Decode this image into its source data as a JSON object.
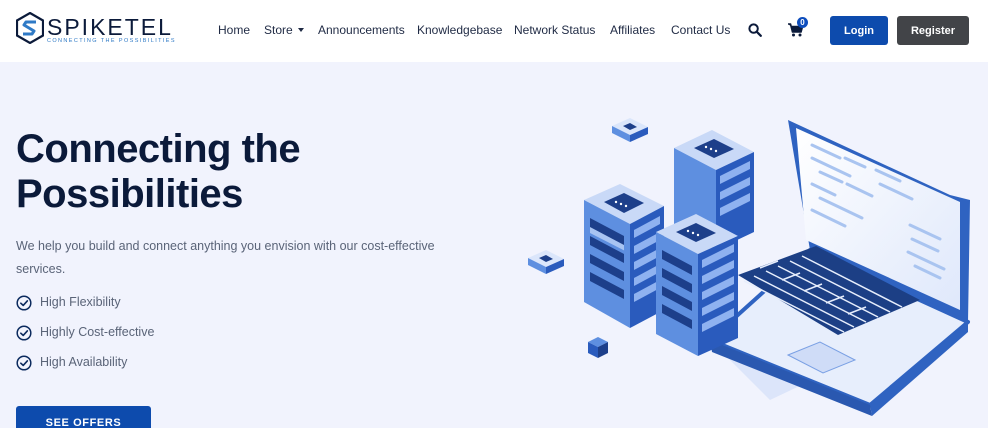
{
  "brand": {
    "name": "SPIKETEL",
    "tagline": "Connecting the Possibilities",
    "primary_color": "#0d4bad",
    "accent_color": "#2f7ac6"
  },
  "nav": {
    "items": [
      {
        "label": "Home"
      },
      {
        "label": "Store",
        "dropdown": true
      },
      {
        "label": "Announcements"
      },
      {
        "label": "Knowledgebase"
      },
      {
        "label": "Network Status"
      },
      {
        "label": "Affiliates"
      },
      {
        "label": "Contact Us"
      }
    ],
    "search_icon": "search-icon",
    "cart_icon": "cart-icon",
    "cart_count": "0",
    "login_label": "Login",
    "register_label": "Register"
  },
  "hero": {
    "title_line1": "Connecting the",
    "title_line2": "Possibilities",
    "subtitle": "We help you build and connect anything you envision with our cost-effective services.",
    "features": [
      "High Flexibility",
      "Highly Cost-effective",
      "High Availability"
    ],
    "cta_label": "SEE OFFERS"
  }
}
